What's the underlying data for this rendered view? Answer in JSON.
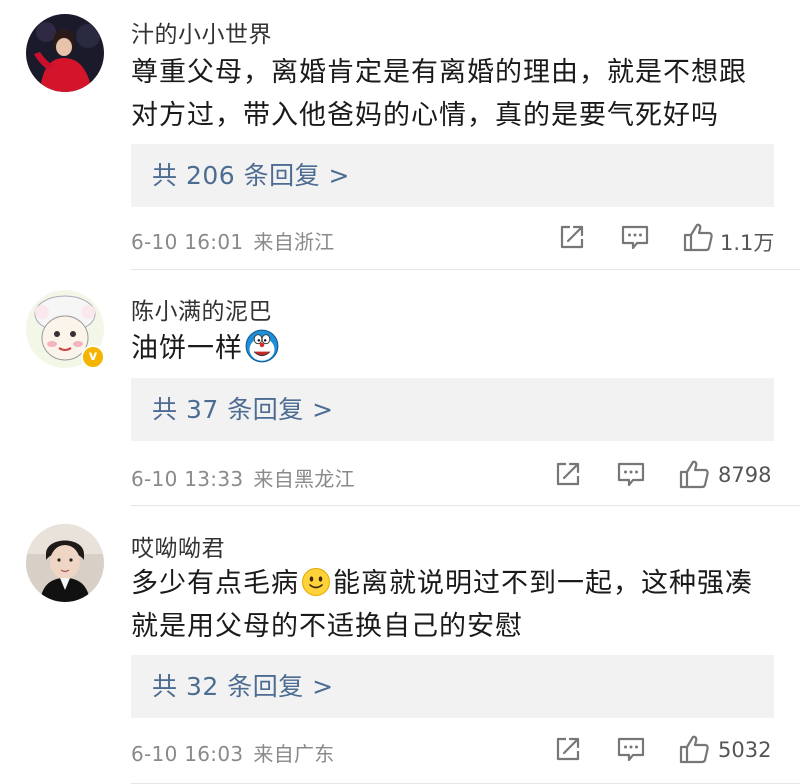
{
  "comments": [
    {
      "username": "汁的小小世界",
      "text_lines": [
        "尊重父母，离婚肯定是有离婚的理由，就是不想跟",
        "对方过，带入他爸妈的心情，真的是要气死好吗"
      ],
      "replies": "共 206 条回复 >",
      "time": "6-10 16:01",
      "location": "来自浙江",
      "likes": "1.1万",
      "share_icon": "share-icon",
      "comment_icon": "comment-icon",
      "like_icon": "thumbs-up-icon"
    },
    {
      "username": "陈小满的泥巴",
      "text": "油饼一样",
      "emoji": "doraemon-emoji",
      "verified_badge": "v",
      "replies": "共 37 条回复 >",
      "time": "6-10 13:33",
      "location": "来自黑龙江",
      "likes": "8798"
    },
    {
      "username": "哎呦呦君",
      "text_line1_a": "多少有点毛病",
      "text_line1_emoji": "smile-emoji",
      "text_line1_b": "能离就说明过不到一起，这种强凑",
      "text_line2": "就是用父母的不适换自己的安慰",
      "replies": "共 32 条回复 >",
      "time": "6-10 16:03",
      "location": "来自广东",
      "likes": "5032"
    }
  ],
  "colors": {
    "reply_link": "#4d6c92",
    "reply_bg": "#f2f2f2",
    "meta": "#8a8a8a",
    "verified": "#f4b400"
  }
}
